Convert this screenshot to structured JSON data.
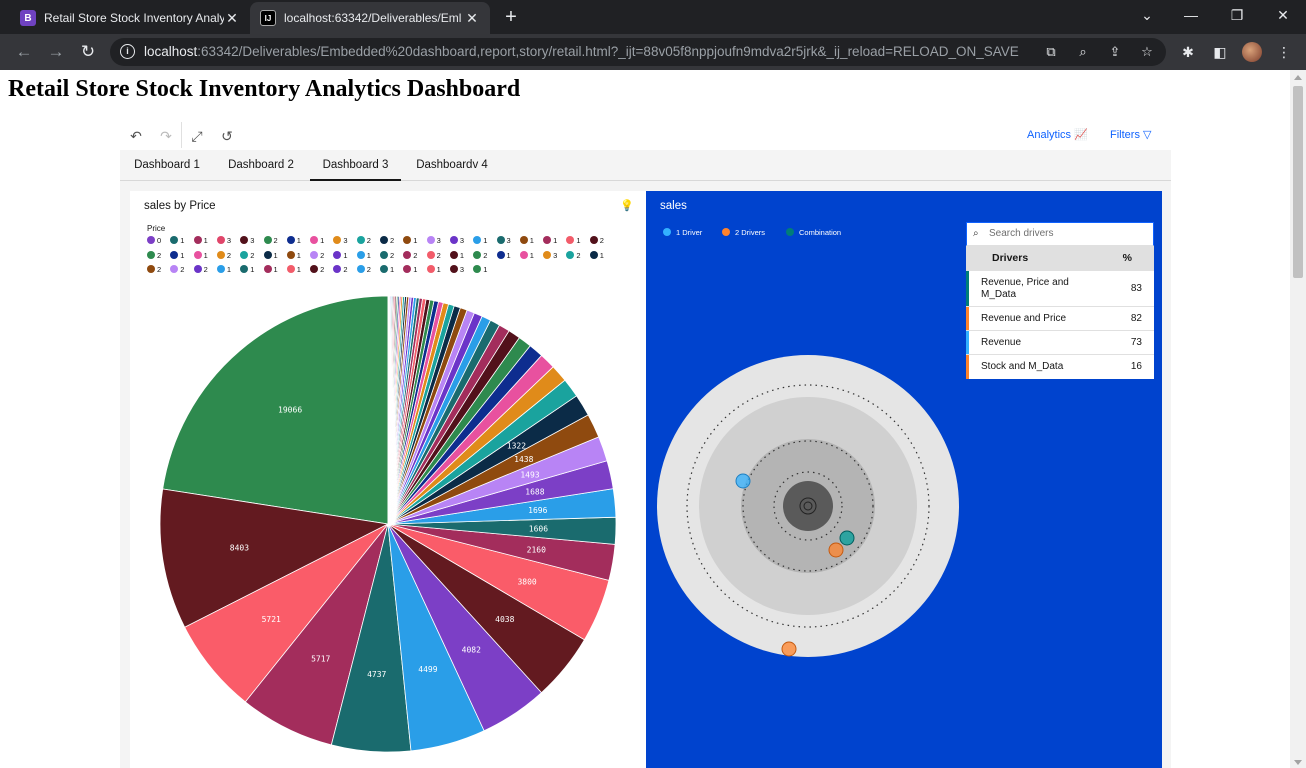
{
  "browser": {
    "tabs": [
      {
        "title": "Retail Store Stock Inventory Analy",
        "favicon": "B",
        "active": false
      },
      {
        "title": "localhost:63342/Deliverables/Eml",
        "favicon": "IJ",
        "active": true
      }
    ],
    "new_tab": "+",
    "url_host": "localhost",
    "url_rest": ":63342/Deliverables/Embedded%20dashboard,report,story/retail.html?_ijt=88v05f8nppjoufn9mdva2r5jrk&_ij_reload=RELOAD_ON_SAVE",
    "icons": {
      "back": "arrow-left-icon",
      "forward": "arrow-right-icon",
      "reload": "reload-icon",
      "info": "info-icon",
      "translate": "translate-icon",
      "zoom": "zoom-icon",
      "share": "share-icon",
      "bookmark": "star-icon",
      "extensions": "puzzle-icon",
      "sidebar": "sidebar-icon",
      "menu": "kebab-icon"
    }
  },
  "page": {
    "title": "Retail Store Stock Inventory Analytics Dashboard"
  },
  "dashboard": {
    "toolbar": {
      "analytics": "Analytics",
      "filters": "Filters"
    },
    "tabs": [
      "Dashboard 1",
      "Dashboard 2",
      "Dashboard 3",
      "Dashboardv 4"
    ],
    "selected_tab": 2,
    "left_panel": {
      "title": "sales by Price",
      "legend_title": "Price",
      "legend_rows": [
        [
          [
            "0",
            "#7c3fc6"
          ],
          [
            "1",
            "#1a6b6e"
          ],
          [
            "1",
            "#a32d5c"
          ],
          [
            "3",
            "#e0466a"
          ],
          [
            "3",
            "#52111b"
          ],
          [
            "2",
            "#2e8a4e"
          ],
          [
            "1",
            "#0e2d8f"
          ],
          [
            "1",
            "#e8519f"
          ],
          [
            "3",
            "#e08b1a"
          ],
          [
            "2",
            "#1aa39e"
          ],
          [
            "2",
            "#0b2b47"
          ],
          [
            "1",
            "#8f4a0f"
          ],
          [
            "3",
            "#b884f5"
          ],
          [
            "3",
            "#6b34c8"
          ],
          [
            "1",
            "#2a9ee8"
          ],
          [
            "3",
            "#1a6b6e"
          ],
          [
            "1",
            "#8f4a0f"
          ],
          [
            "1",
            "#a32d5c"
          ],
          [
            "1",
            "#f25c6a"
          ],
          [
            "2",
            "#52111b"
          ]
        ],
        [
          [
            "2",
            "#2e8a4e"
          ],
          [
            "1",
            "#0e2d8f"
          ],
          [
            "1",
            "#e8519f"
          ],
          [
            "2",
            "#e08b1a"
          ],
          [
            "2",
            "#1aa39e"
          ],
          [
            "1",
            "#0b2b47"
          ],
          [
            "1",
            "#8f4a0f"
          ],
          [
            "2",
            "#b884f5"
          ],
          [
            "1",
            "#6b34c8"
          ],
          [
            "1",
            "#2a9ee8"
          ],
          [
            "2",
            "#1a6b6e"
          ],
          [
            "2",
            "#a32d5c"
          ],
          [
            "2",
            "#f25c6a"
          ],
          [
            "1",
            "#52111b"
          ],
          [
            "2",
            "#2e8a4e"
          ],
          [
            "1",
            "#0e2d8f"
          ],
          [
            "1",
            "#e8519f"
          ],
          [
            "3",
            "#e08b1a"
          ],
          [
            "2",
            "#1aa39e"
          ],
          [
            "1",
            "#0b2b47"
          ]
        ],
        [
          [
            "2",
            "#8f4a0f"
          ],
          [
            "2",
            "#b884f5"
          ],
          [
            "2",
            "#6b34c8"
          ],
          [
            "1",
            "#2a9ee8"
          ],
          [
            "1",
            "#1a6b6e"
          ],
          [
            "1",
            "#a32d5c"
          ],
          [
            "1",
            "#f25c6a"
          ],
          [
            "2",
            "#52111b"
          ],
          [
            "2",
            "#6b34c8"
          ],
          [
            "2",
            "#2a9ee8"
          ],
          [
            "1",
            "#1a6b6e"
          ],
          [
            "1",
            "#a32d5c"
          ],
          [
            "1",
            "#f25c6a"
          ],
          [
            "3",
            "#52111b"
          ],
          [
            "1",
            "#2e8a4e"
          ]
        ]
      ]
    },
    "right_panel": {
      "title": "sales",
      "legend": [
        {
          "label": "1 Driver",
          "color": "#33b1ff"
        },
        {
          "label": "2 Drivers",
          "color": "#ff832b"
        },
        {
          "label": "Combination",
          "color": "#007d79"
        }
      ],
      "search_placeholder": "Search drivers",
      "columns": [
        "Drivers",
        "%"
      ],
      "rows": [
        {
          "name": "Revenue, Price and M_Data",
          "pct": "83",
          "color": "#007d79"
        },
        {
          "name": "Revenue and Price",
          "pct": "82",
          "color": "#ff832b"
        },
        {
          "name": "Revenue",
          "pct": "73",
          "color": "#33b1ff"
        },
        {
          "name": "Stock and M_Data",
          "pct": "16",
          "color": "#ff832b"
        }
      ]
    }
  },
  "chart_data": {
    "type": "pie",
    "title": "sales by Price",
    "labeled_slices": [
      {
        "value": 19066,
        "color": "#2e8a4e"
      },
      {
        "value": 8403,
        "color": "#631a20"
      },
      {
        "value": 5721,
        "color": "#fa5c69"
      },
      {
        "value": 5717,
        "color": "#a32d5c"
      },
      {
        "value": 4737,
        "color": "#1a6b6e"
      },
      {
        "value": 4499,
        "color": "#2a9ee8"
      },
      {
        "value": 4082,
        "color": "#7c3fc6"
      },
      {
        "value": 4038,
        "color": "#631a20"
      },
      {
        "value": 3800,
        "color": "#fa5c69"
      },
      {
        "value": 2160,
        "color": "#a32d5c"
      },
      {
        "value": 1606,
        "color": "#1a6b6e"
      },
      {
        "value": 1696,
        "color": "#2a9ee8"
      },
      {
        "value": 1688,
        "color": "#7c3fc6"
      },
      {
        "value": 1493,
        "color": "#b884f5"
      },
      {
        "value": 1438,
        "color": "#8f4a0f"
      },
      {
        "value": 1322,
        "color": "#0b2b47"
      }
    ],
    "small_slice_colors": [
      "#1aa39e",
      "#e08b1a",
      "#e8519f",
      "#0e2d8f",
      "#2e8a4e",
      "#52111b",
      "#a32d5c",
      "#1a6b6e",
      "#2a9ee8",
      "#6b34c8",
      "#b884f5",
      "#8f4a0f",
      "#0b2b47",
      "#1aa39e",
      "#e08b1a",
      "#e8519f",
      "#0e2d8f",
      "#2e8a4e",
      "#52111b",
      "#f25c6a",
      "#a32d5c",
      "#1a6b6e",
      "#2a9ee8",
      "#6b34c8",
      "#b884f5",
      "#8f4a0f",
      "#0b2b47",
      "#1aa39e",
      "#e08b1a",
      "#e8519f",
      "#0e2d8f",
      "#2e8a4e",
      "#52111b",
      "#f25c6a",
      "#a32d5c",
      "#1a6b6e",
      "#2a9ee8",
      "#6b34c8",
      "#b884f5",
      "#8f4a0f"
    ],
    "small_slice_values": [
      1150,
      1050,
      960,
      880,
      800,
      730,
      660,
      600,
      550,
      500,
      460,
      420,
      380,
      350,
      320,
      290,
      270,
      250,
      230,
      210,
      190,
      175,
      160,
      150,
      140,
      130,
      120,
      110,
      100,
      95,
      90,
      85,
      80,
      75,
      70,
      65,
      60,
      55,
      50,
      45
    ]
  }
}
